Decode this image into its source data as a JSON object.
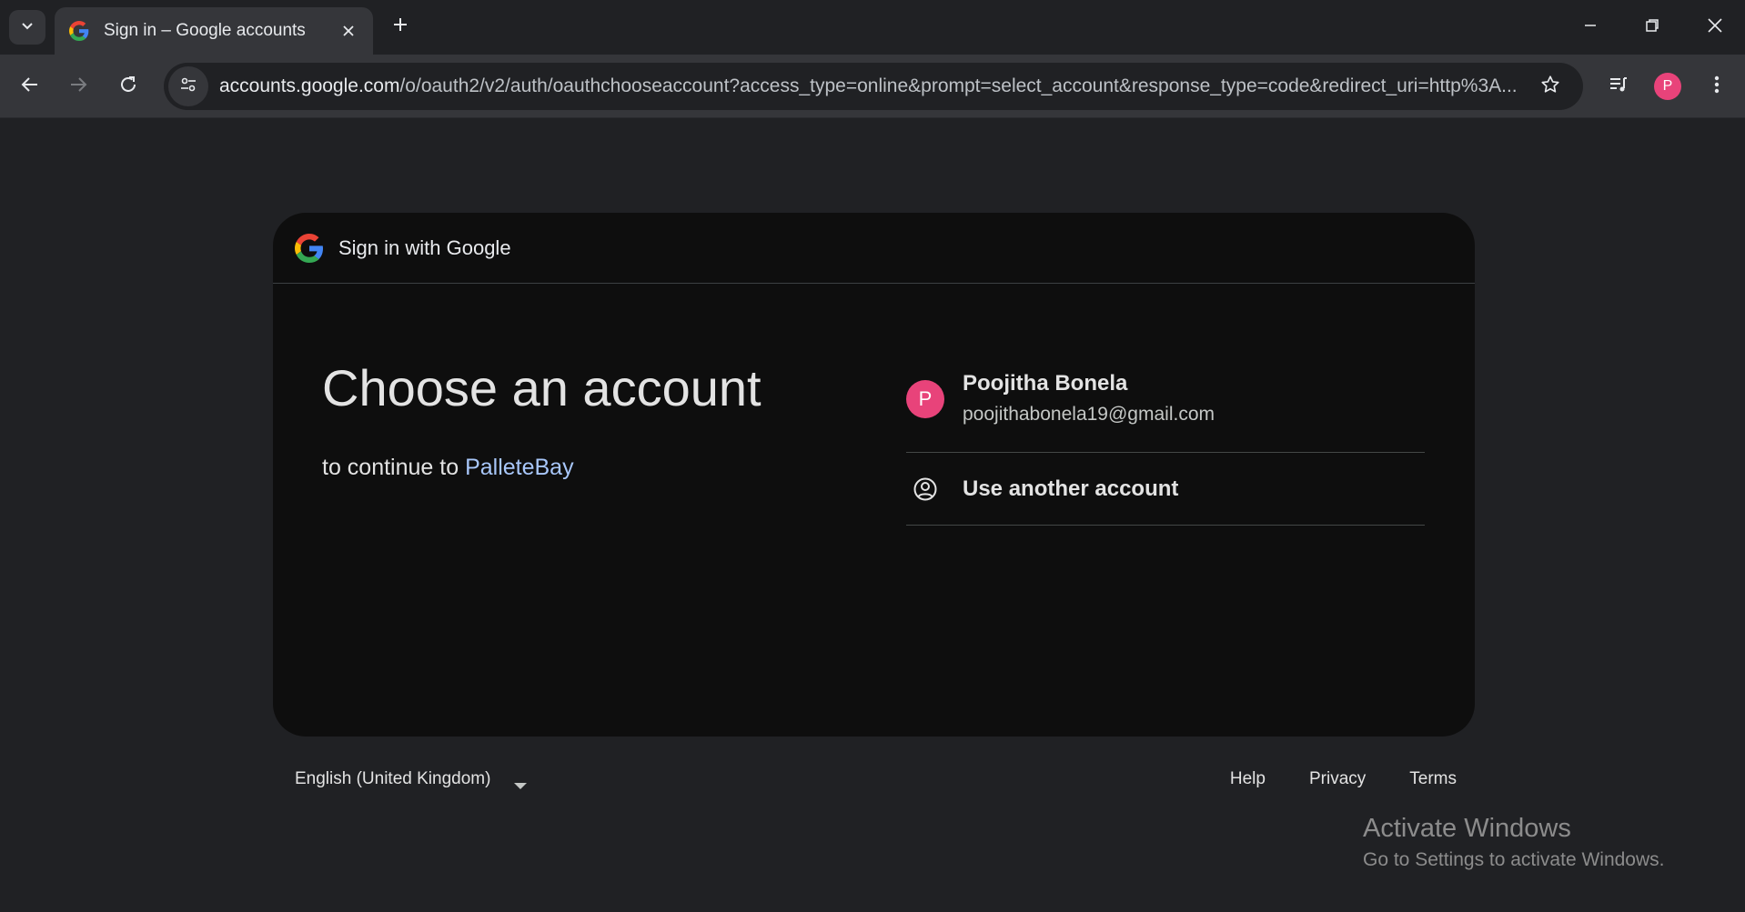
{
  "browser": {
    "tab": {
      "title": "Sign in – Google accounts"
    },
    "address_bar": {
      "host": "accounts.google.com",
      "path": "/o/oauth2/v2/auth/oauthchooseaccount?access_type=online&prompt=select_account&response_type=code&redirect_uri=http%3A..."
    },
    "profile_initial": "P"
  },
  "card": {
    "header_text": "Sign in with Google",
    "title": "Choose an account",
    "subtitle_prefix": "to continue to ",
    "app_name": "PalleteBay",
    "accounts": [
      {
        "initial": "P",
        "name": "Poojitha Bonela",
        "email": "poojithabonela19@gmail.com"
      }
    ],
    "use_another_label": "Use another account"
  },
  "footer": {
    "language": "English (United Kingdom)",
    "links": [
      "Help",
      "Privacy",
      "Terms"
    ]
  },
  "watermark": {
    "title": "Activate Windows",
    "subtitle": "Go to Settings to activate Windows."
  },
  "colors": {
    "avatar": "#e8437a",
    "link": "#a8c7fa",
    "card_bg": "#0e0e0e",
    "page_bg": "#202124"
  }
}
